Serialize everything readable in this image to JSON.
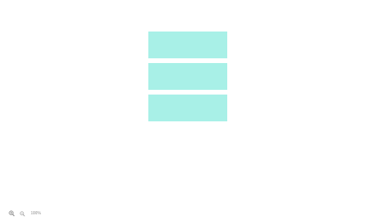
{
  "canvas": {
    "blocks": [
      {
        "color": "#a8f0e7"
      },
      {
        "color": "#a8f0e7"
      },
      {
        "color": "#a8f0e7"
      }
    ]
  },
  "zoom": {
    "zoom_in_icon": "zoom-in-icon",
    "zoom_out_icon": "zoom-out-icon",
    "level": "100%",
    "icon_color": "#888888"
  }
}
